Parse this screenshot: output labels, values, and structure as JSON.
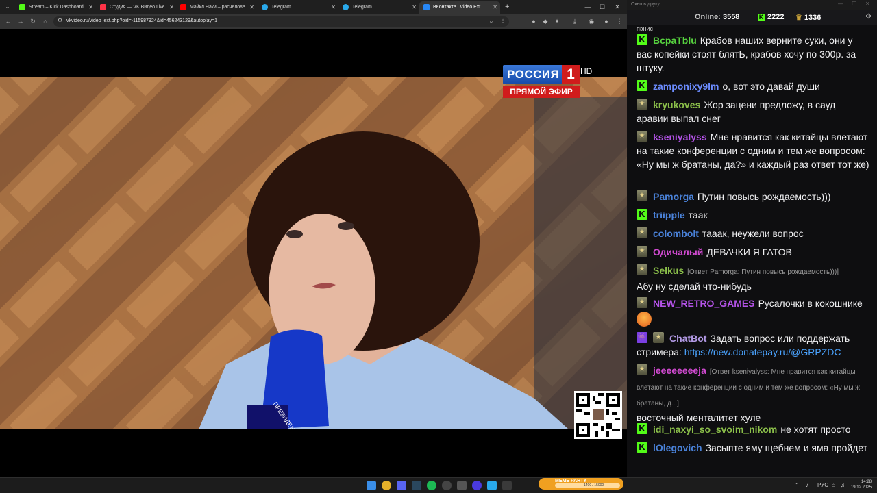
{
  "browser": {
    "tabs": [
      {
        "label": "Stream – Kick Dashboard",
        "icon": "kick-icon",
        "color": "#53fc18"
      },
      {
        "label": "Студия — VK Видео Live",
        "icon": "vk-video-icon",
        "color": "#ff3347"
      },
      {
        "label": "Майкл Наки – расчеловечива",
        "icon": "youtube-icon",
        "color": "#ff0000"
      },
      {
        "label": "Telegram",
        "icon": "telegram-icon",
        "color": "#29a9eb"
      },
      {
        "label": "Telegram",
        "icon": "telegram-icon",
        "color": "#29a9eb"
      },
      {
        "label": "ВКонтакте | Video Ext",
        "icon": "vk-icon",
        "color": "#2787f5"
      }
    ],
    "url": "vkvideo.ru/video_ext.php?oid=-115987924&id=456243129&autoplay=1"
  },
  "video": {
    "channel": {
      "name": "РОССИЯ",
      "number": "1",
      "quality": "HD",
      "live_label": "ПРЯМОЙ ЭФИР"
    },
    "mic_label": "ПРЕЗИДЕНТ РФ"
  },
  "chat": {
    "window_title": "Окно в друку",
    "online_label": "Online:",
    "online_count": "3558",
    "kick_count": "2222",
    "other_count": "1336",
    "top_fragment": "пэнис",
    "messages": [
      {
        "badge": "kick",
        "nick": "BcpaTblu",
        "nick_color": "#57d33f",
        "text": "Крабов наших верните суки, они у вас копейки стоят блятЬ, крабов хочу по 300р. за штуку."
      },
      {
        "badge": "kick",
        "nick": "zamponixy9lm",
        "nick_color": "#6c8cff",
        "text": "о, вот это давай души"
      },
      {
        "badge": "sub",
        "nick": "kryukoves",
        "nick_color": "#8bbf4a",
        "text": "Жор зацени предложу, в сауд аравии выпал снег"
      },
      {
        "badge": "sub",
        "nick": "kseniyalyss",
        "nick_color": "#b453e8",
        "text": "Мне нравится как китайцы влетают на такие конференции с одним и тем же вопросом: «Ну мы ж братаны, да?» и каждый раз ответ тот же)"
      },
      {
        "badge": "sub",
        "nick": "Pamorga",
        "nick_color": "#4a82d9",
        "text": "Путин повысь рождаемость)))"
      },
      {
        "badge": "kick",
        "nick": "triipple",
        "nick_color": "#4a82d9",
        "text": "таак"
      },
      {
        "badge": "sub",
        "nick": "colombolt",
        "nick_color": "#4a82d9",
        "text": "тааак, неужели вопрос"
      },
      {
        "badge": "sub",
        "nick": "Одичалый",
        "nick_color": "#d04ad0",
        "text": "ДЕВАЧКИ Я ГАТОВ"
      },
      {
        "badge": "sub",
        "nick": "Selkus",
        "nick_color": "#8bbf4a",
        "reply": "[Ответ Pamorga: Путин повысь рождаемость)))]",
        "text": "Абу ну сделай что-нибудь"
      },
      {
        "badge": "sub",
        "nick": "NEW_RETRO_GAMES",
        "nick_color": "#b453e8",
        "text": "Русалочки в кокошнике"
      },
      {
        "badge": "bot",
        "nick": "ChatBot",
        "nick_color": "#b39ae6",
        "text": "Задать вопрос или поддержать стримера: ",
        "link": "https://new.donatepay.ru/@GRPZDC"
      },
      {
        "badge": "sub",
        "nick": "jeeeeeeeeja",
        "nick_color": "#d04ad0",
        "reply": "[Ответ kseniyalyss: Мне нравится как китайцы влетают на такие конференции с одним и тем же вопросом: «Ну мы ж братаны, д...]",
        "text": "восточный менталитет хуле"
      },
      {
        "badge": "kick",
        "nick": "idi_naxyi_so_svoim_nikom",
        "nick_color": "#8bbf4a",
        "text": "не хотят просто"
      },
      {
        "badge": "kick",
        "nick": "lOlegovich",
        "nick_color": "#4a82d9",
        "text": "Засыпте яму щебнем и яма пройдет"
      }
    ]
  },
  "taskbar": {
    "meme_title": "MEME PARTY",
    "meme_count": "1400 / 15000",
    "lang": "РУС",
    "time": "14:28",
    "date": "19.12.2025"
  }
}
